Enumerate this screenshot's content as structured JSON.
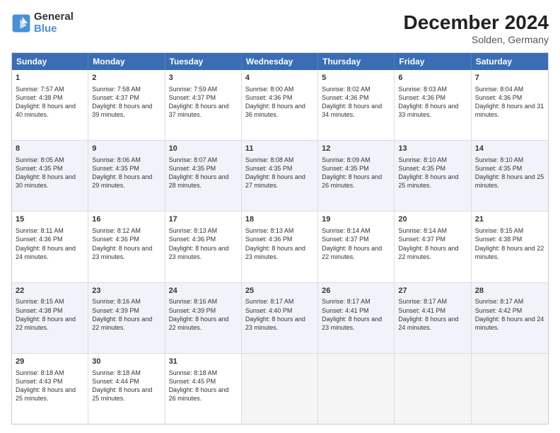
{
  "logo": {
    "line1": "General",
    "line2": "Blue"
  },
  "title": "December 2024",
  "subtitle": "Solden, Germany",
  "headers": [
    "Sunday",
    "Monday",
    "Tuesday",
    "Wednesday",
    "Thursday",
    "Friday",
    "Saturday"
  ],
  "weeks": [
    {
      "alt": false,
      "days": [
        {
          "num": "1",
          "rise": "7:57 AM",
          "set": "4:38 PM",
          "daylight": "8 hours and 40 minutes."
        },
        {
          "num": "2",
          "rise": "7:58 AM",
          "set": "4:37 PM",
          "daylight": "8 hours and 39 minutes."
        },
        {
          "num": "3",
          "rise": "7:59 AM",
          "set": "4:37 PM",
          "daylight": "8 hours and 37 minutes."
        },
        {
          "num": "4",
          "rise": "8:00 AM",
          "set": "4:36 PM",
          "daylight": "8 hours and 36 minutes."
        },
        {
          "num": "5",
          "rise": "8:02 AM",
          "set": "4:36 PM",
          "daylight": "8 hours and 34 minutes."
        },
        {
          "num": "6",
          "rise": "8:03 AM",
          "set": "4:36 PM",
          "daylight": "8 hours and 33 minutes."
        },
        {
          "num": "7",
          "rise": "8:04 AM",
          "set": "4:36 PM",
          "daylight": "8 hours and 31 minutes."
        }
      ]
    },
    {
      "alt": true,
      "days": [
        {
          "num": "8",
          "rise": "8:05 AM",
          "set": "4:35 PM",
          "daylight": "8 hours and 30 minutes."
        },
        {
          "num": "9",
          "rise": "8:06 AM",
          "set": "4:35 PM",
          "daylight": "8 hours and 29 minutes."
        },
        {
          "num": "10",
          "rise": "8:07 AM",
          "set": "4:35 PM",
          "daylight": "8 hours and 28 minutes."
        },
        {
          "num": "11",
          "rise": "8:08 AM",
          "set": "4:35 PM",
          "daylight": "8 hours and 27 minutes."
        },
        {
          "num": "12",
          "rise": "8:09 AM",
          "set": "4:35 PM",
          "daylight": "8 hours and 26 minutes."
        },
        {
          "num": "13",
          "rise": "8:10 AM",
          "set": "4:35 PM",
          "daylight": "8 hours and 25 minutes."
        },
        {
          "num": "14",
          "rise": "8:10 AM",
          "set": "4:35 PM",
          "daylight": "8 hours and 25 minutes."
        }
      ]
    },
    {
      "alt": false,
      "days": [
        {
          "num": "15",
          "rise": "8:11 AM",
          "set": "4:36 PM",
          "daylight": "8 hours and 24 minutes."
        },
        {
          "num": "16",
          "rise": "8:12 AM",
          "set": "4:36 PM",
          "daylight": "8 hours and 23 minutes."
        },
        {
          "num": "17",
          "rise": "8:13 AM",
          "set": "4:36 PM",
          "daylight": "8 hours and 23 minutes."
        },
        {
          "num": "18",
          "rise": "8:13 AM",
          "set": "4:36 PM",
          "daylight": "8 hours and 23 minutes."
        },
        {
          "num": "19",
          "rise": "8:14 AM",
          "set": "4:37 PM",
          "daylight": "8 hours and 22 minutes."
        },
        {
          "num": "20",
          "rise": "8:14 AM",
          "set": "4:37 PM",
          "daylight": "8 hours and 22 minutes."
        },
        {
          "num": "21",
          "rise": "8:15 AM",
          "set": "4:38 PM",
          "daylight": "8 hours and 22 minutes."
        }
      ]
    },
    {
      "alt": true,
      "days": [
        {
          "num": "22",
          "rise": "8:15 AM",
          "set": "4:38 PM",
          "daylight": "8 hours and 22 minutes."
        },
        {
          "num": "23",
          "rise": "8:16 AM",
          "set": "4:39 PM",
          "daylight": "8 hours and 22 minutes."
        },
        {
          "num": "24",
          "rise": "8:16 AM",
          "set": "4:39 PM",
          "daylight": "8 hours and 22 minutes."
        },
        {
          "num": "25",
          "rise": "8:17 AM",
          "set": "4:40 PM",
          "daylight": "8 hours and 23 minutes."
        },
        {
          "num": "26",
          "rise": "8:17 AM",
          "set": "4:41 PM",
          "daylight": "8 hours and 23 minutes."
        },
        {
          "num": "27",
          "rise": "8:17 AM",
          "set": "4:41 PM",
          "daylight": "8 hours and 24 minutes."
        },
        {
          "num": "28",
          "rise": "8:17 AM",
          "set": "4:42 PM",
          "daylight": "8 hours and 24 minutes."
        }
      ]
    },
    {
      "alt": false,
      "days": [
        {
          "num": "29",
          "rise": "8:18 AM",
          "set": "4:43 PM",
          "daylight": "8 hours and 25 minutes."
        },
        {
          "num": "30",
          "rise": "8:18 AM",
          "set": "4:44 PM",
          "daylight": "8 hours and 25 minutes."
        },
        {
          "num": "31",
          "rise": "8:18 AM",
          "set": "4:45 PM",
          "daylight": "8 hours and 26 minutes."
        },
        null,
        null,
        null,
        null
      ]
    }
  ]
}
